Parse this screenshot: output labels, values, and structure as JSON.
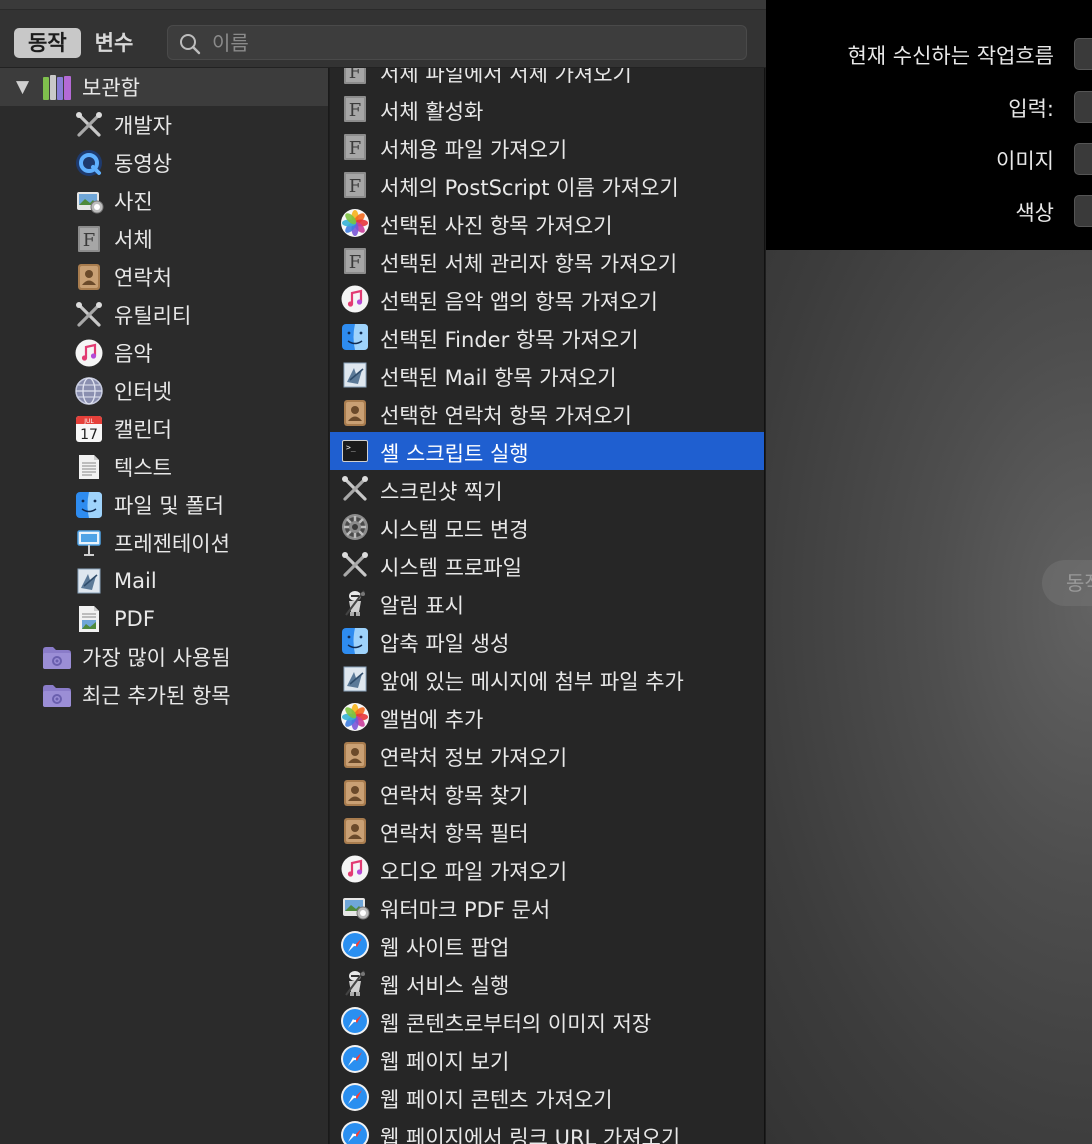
{
  "toolbar": {
    "tab_actions": "동작",
    "tab_variables": "변수",
    "search_placeholder": "이름"
  },
  "sidebar": {
    "library": {
      "label": "보관함",
      "icon": "library-icon"
    },
    "items": [
      {
        "label": "개발자",
        "icon": "tools-icon"
      },
      {
        "label": "동영상",
        "icon": "quicktime-icon"
      },
      {
        "label": "사진",
        "icon": "preview-icon"
      },
      {
        "label": "서체",
        "icon": "font-icon"
      },
      {
        "label": "연락처",
        "icon": "contacts-icon"
      },
      {
        "label": "유틸리티",
        "icon": "tools-icon"
      },
      {
        "label": "음악",
        "icon": "music-icon"
      },
      {
        "label": "인터넷",
        "icon": "globe-icon"
      },
      {
        "label": "캘린더",
        "icon": "calendar-icon"
      },
      {
        "label": "텍스트",
        "icon": "text-icon"
      },
      {
        "label": "파일 및 폴더",
        "icon": "finder-icon"
      },
      {
        "label": "프레젠테이션",
        "icon": "keynote-icon"
      },
      {
        "label": "Mail",
        "icon": "mail-icon"
      },
      {
        "label": "PDF",
        "icon": "pdf-icon"
      }
    ],
    "smart_folders": [
      {
        "label": "가장 많이 사용됨",
        "icon": "smart-folder-icon"
      },
      {
        "label": "최근 추가된 항목",
        "icon": "smart-folder-icon"
      }
    ],
    "calendar_month": "JUL",
    "calendar_day": "17"
  },
  "actions": [
    {
      "label": "서체 파일에서 서체 가져오기",
      "icon": "font-icon"
    },
    {
      "label": "서체 활성화",
      "icon": "font-icon"
    },
    {
      "label": "서체용 파일 가져오기",
      "icon": "font-icon"
    },
    {
      "label": "서체의 PostScript 이름 가져오기",
      "icon": "font-icon"
    },
    {
      "label": "선택된 사진 항목 가져오기",
      "icon": "photos-icon"
    },
    {
      "label": "선택된 서체 관리자 항목 가져오기",
      "icon": "font-icon"
    },
    {
      "label": "선택된 음악 앱의 항목 가져오기",
      "icon": "music-icon"
    },
    {
      "label": "선택된 Finder 항목 가져오기",
      "icon": "finder-icon"
    },
    {
      "label": "선택된 Mail 항목 가져오기",
      "icon": "mail-icon"
    },
    {
      "label": "선택한 연락처 항목 가져오기",
      "icon": "contacts-icon"
    },
    {
      "label": "셸 스크립트 실행",
      "icon": "terminal-icon",
      "selected": true
    },
    {
      "label": "스크린샷 찍기",
      "icon": "tools-icon"
    },
    {
      "label": "시스템 모드 변경",
      "icon": "system-prefs-icon"
    },
    {
      "label": "시스템 프로파일",
      "icon": "tools-icon"
    },
    {
      "label": "알림 표시",
      "icon": "automator-icon"
    },
    {
      "label": "압축 파일 생성",
      "icon": "finder-icon"
    },
    {
      "label": "앞에 있는 메시지에 첨부 파일 추가",
      "icon": "mail-icon"
    },
    {
      "label": "앨범에 추가",
      "icon": "photos-icon"
    },
    {
      "label": "연락처 정보 가져오기",
      "icon": "contacts-icon"
    },
    {
      "label": "연락처 항목 찾기",
      "icon": "contacts-icon"
    },
    {
      "label": "연락처 항목 필터",
      "icon": "contacts-icon"
    },
    {
      "label": "오디오 파일 가져오기",
      "icon": "music-icon"
    },
    {
      "label": "워터마크 PDF 문서",
      "icon": "preview-icon"
    },
    {
      "label": "웹 사이트 팝업",
      "icon": "safari-icon"
    },
    {
      "label": "웹 서비스 실행",
      "icon": "automator-icon"
    },
    {
      "label": "웹 콘텐츠로부터의 이미지 저장",
      "icon": "safari-icon"
    },
    {
      "label": "웹 페이지 보기",
      "icon": "safari-icon"
    },
    {
      "label": "웹 페이지 콘텐츠 가져오기",
      "icon": "safari-icon"
    },
    {
      "label": "웹 페이지에서 링크 URL 가져오기",
      "icon": "safari-icon"
    }
  ],
  "workflow_settings": {
    "receives_label": "현재 수신하는 작업흐름",
    "input_label": "입력:",
    "image_label": "이미지",
    "color_label": "색상"
  },
  "workflow_hint": "동작",
  "colors": {
    "selection": "#1f5fd0",
    "sidebar_bg": "#2b2b2b",
    "list_bg": "#262626"
  }
}
